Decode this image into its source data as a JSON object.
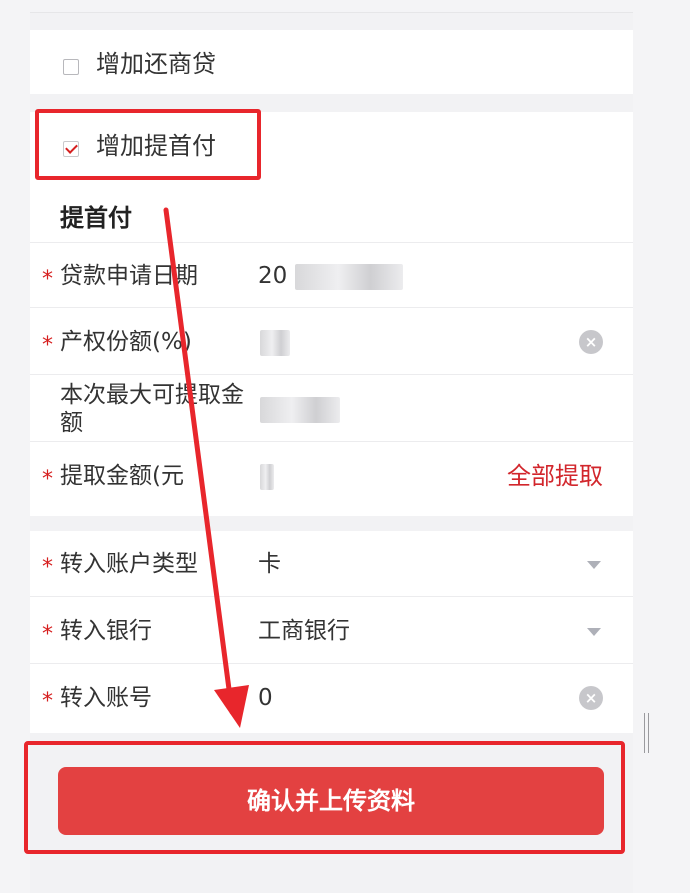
{
  "options": [
    {
      "label": "增加还商贷",
      "checked": false
    },
    {
      "label": "增加提首付",
      "checked": true
    }
  ],
  "section_title": "提首付",
  "fields": [
    {
      "label": "贷款申请日期",
      "required": true,
      "value": "20"
    },
    {
      "label": "产权份额(%)",
      "required": true,
      "value": ""
    },
    {
      "label": "本次最大可提取金额",
      "required": false,
      "value": ""
    },
    {
      "label": "提取金额(元",
      "required": true,
      "value": "",
      "action": "全部提取"
    }
  ],
  "transfer_fields": [
    {
      "label": "转入账户类型",
      "required": true,
      "value": "卡"
    },
    {
      "label": "转入银行",
      "required": true,
      "value": "工商银行"
    },
    {
      "label": "转入账号",
      "required": true,
      "value": "0"
    }
  ],
  "required_mark": "*",
  "clear_glyph": "×",
  "submit_label": "确认并上传资料",
  "colors": {
    "accent": "#e34141",
    "required": "#d61f1f",
    "highlight": "#e8262c",
    "link": "#d2262c"
  }
}
